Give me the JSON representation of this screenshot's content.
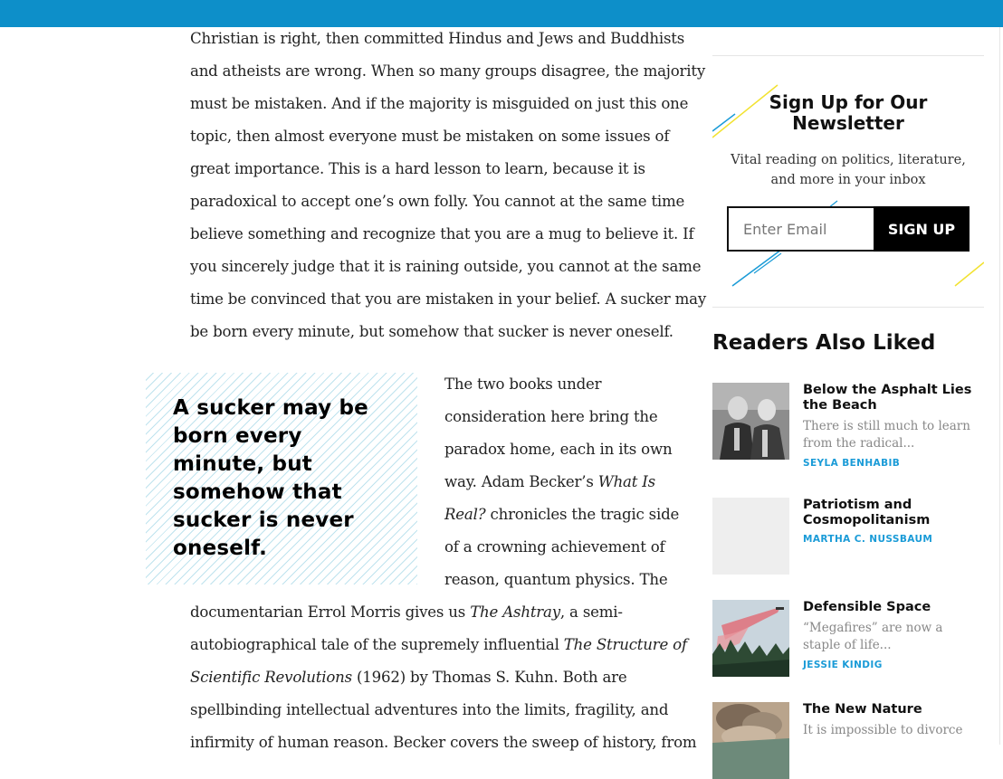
{
  "article": {
    "para1_lines": [
      "Christian is right, then committed Hindus and Jews and Buddhists",
      "and atheists are wrong. When so many groups disagree, the majority",
      "must be mistaken. And if the majority is misguided on just this one",
      "topic, then almost everyone must be mistaken on some issues of",
      "great importance. This is a hard lesson to learn, because it is",
      "paradoxical to accept one’s own folly. You cannot at the same time",
      "believe something and recognize that you are a mug to believe it. If",
      "you sincerely judge that it is raining outside, you cannot at the same",
      "time be convinced that you are mistaken in your belief. A sucker may",
      "be born every minute, but somehow that sucker is never oneself."
    ],
    "pull_quote": "A sucker may be born every minute, but somehow that sucker is never oneself.",
    "para2": {
      "l1": "The two books under",
      "l2": "consideration here bring the",
      "l3": "paradox home, each in its own",
      "l4a": "way. Adam Becker’s ",
      "l4b": "What Is",
      "l5a": "Real?",
      "l5b": " chronicles the tragic side",
      "l6": "of a crowning achievement of",
      "l7": "reason, quantum physics. The"
    },
    "para3": {
      "l1a": "documentarian Errol Morris gives us ",
      "l1b": "The Ashtray",
      "l1c": ", a semi-",
      "l2a": "autobiographical tale of the supremely influential ",
      "l2b": "The Structure of",
      "l3a": "Scientific Revolutions",
      "l3b": " (1962) by Thomas S. Kuhn. Both are",
      "l4": "spellbinding intellectual adventures into the limits, fragility, and",
      "l5": "infirmity of human reason. Becker covers the sweep of history, from"
    }
  },
  "newsletter": {
    "title": "Sign Up for Our Newsletter",
    "subtitle": "Vital reading on politics, literature, and more in your inbox",
    "email_placeholder": "Enter Email",
    "button_label": "SIGN UP",
    "accent_blue": "#1a9bd7",
    "accent_yellow": "#f2e230"
  },
  "readers_also_liked": {
    "heading": "Readers Also Liked",
    "items": [
      {
        "title": "Below the Asphalt Lies the Beach",
        "excerpt": "There is still much to learn from the radical...",
        "author": "SEYLA BENHABIB",
        "thumb": "photo-two-men"
      },
      {
        "title": "Patriotism and Cosmopolitanism",
        "excerpt": "",
        "author": "MARTHA C. NUSSBAUM",
        "thumb": "blank"
      },
      {
        "title": "Defensible Space",
        "excerpt": "“Megafires” are now a staple of life...",
        "author": "JESSIE KINDIG",
        "thumb": "photo-firefighting-plane"
      },
      {
        "title": "The New Nature",
        "excerpt": "It is impossible to divorce",
        "author": "",
        "thumb": "photo-smoke-plume"
      }
    ]
  },
  "colors": {
    "top_bar": "#0d8fc9",
    "link_blue": "#1a9bd7"
  }
}
